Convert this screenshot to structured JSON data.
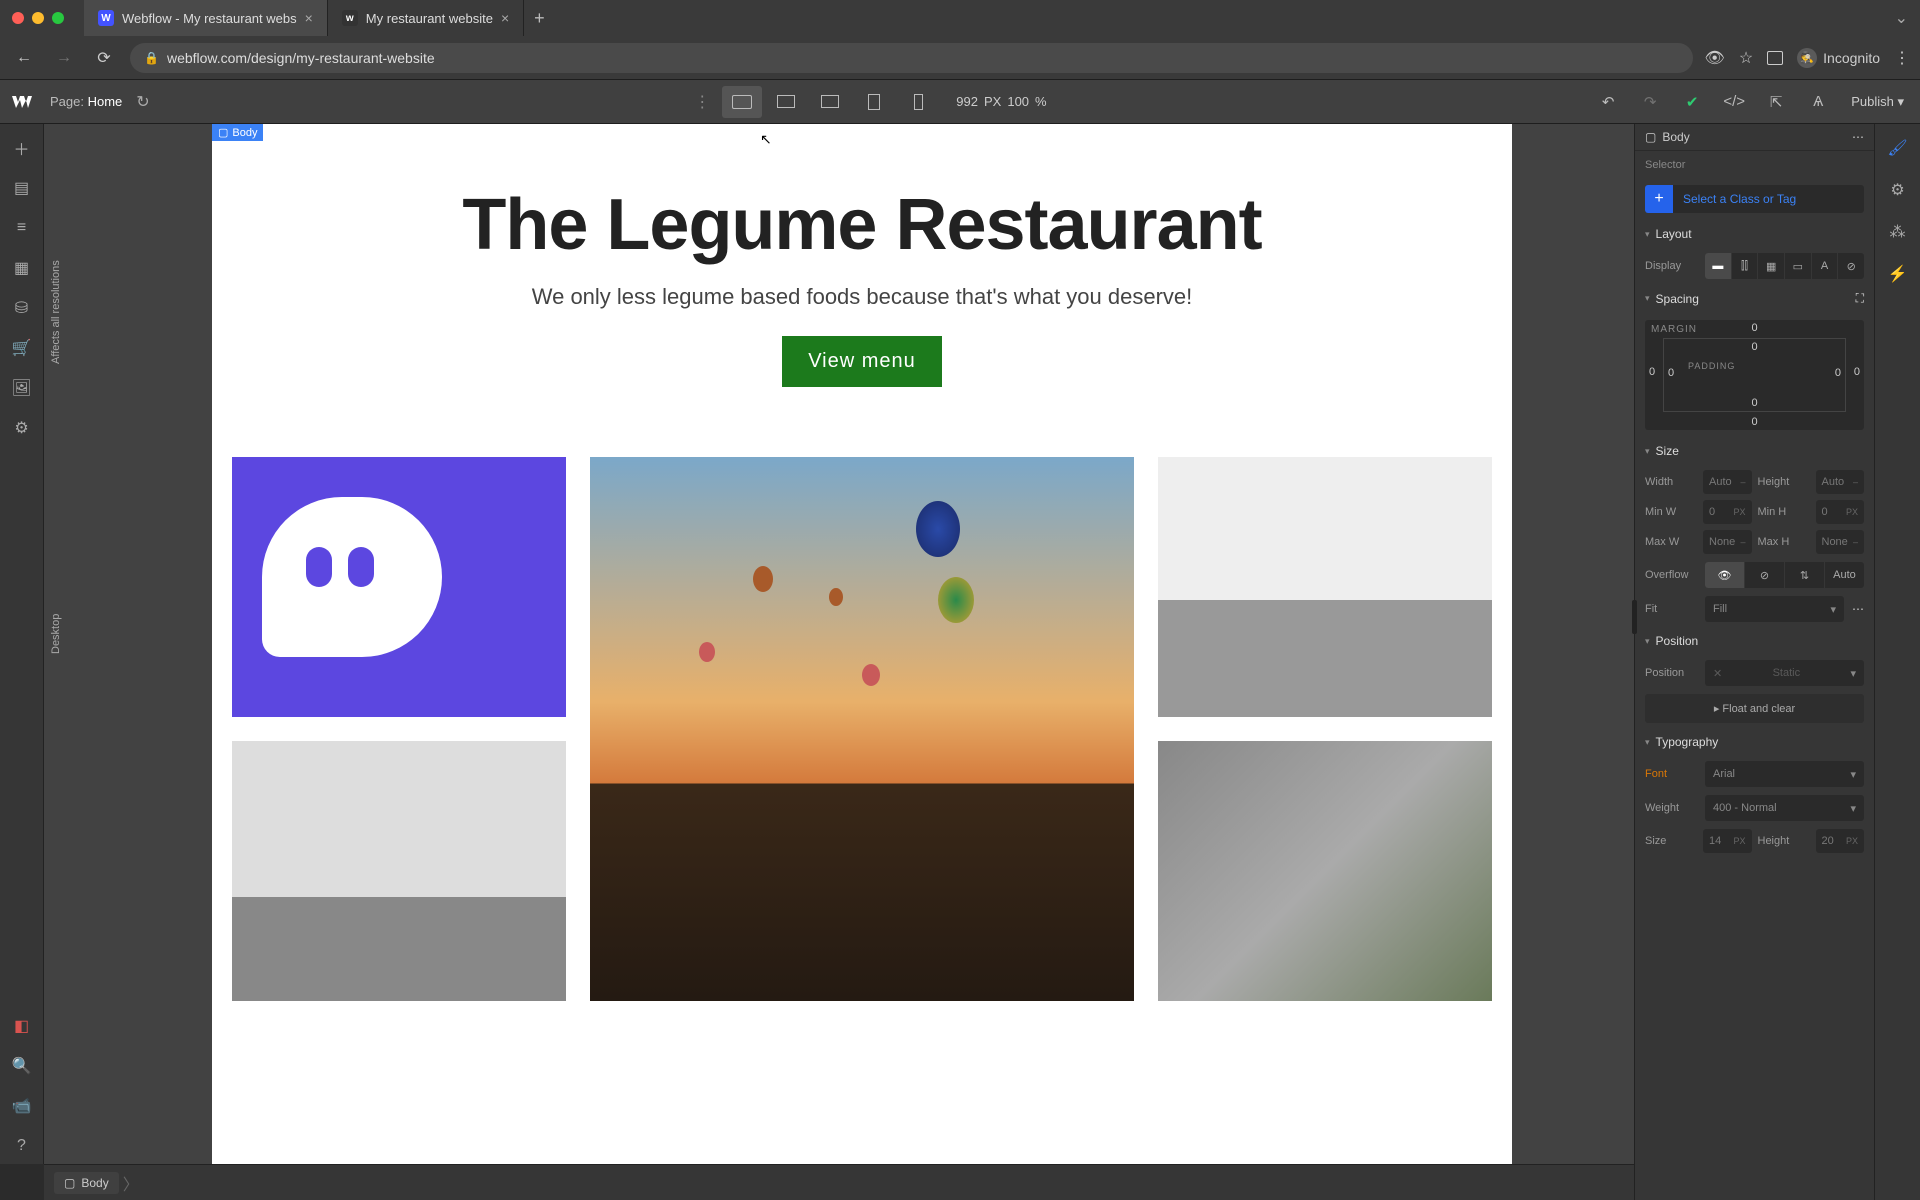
{
  "browser": {
    "tabs": [
      {
        "title": "Webflow - My restaurant webs",
        "active": true
      },
      {
        "title": "My restaurant website",
        "active": false
      }
    ],
    "url": "webflow.com/design/my-restaurant-website",
    "incognito_label": "Incognito"
  },
  "top": {
    "page_label": "Page:",
    "page_name": "Home",
    "viewport_px": "992",
    "viewport_unit": "PX",
    "zoom": "100",
    "zoom_unit": "%",
    "publish": "Publish"
  },
  "canvas": {
    "body_tag": "Body",
    "affects_label": "Affects all resolutions",
    "bp_label": "Desktop",
    "hero_title": "The Legume Restaurant",
    "hero_sub": "We only less legume based foods because that's what you deserve!",
    "cta": "View menu"
  },
  "breadcrumb": {
    "item": "Body"
  },
  "panel": {
    "element": "Body",
    "selector_head": "Selector",
    "selector_placeholder": "Select a Class or Tag",
    "layout": {
      "title": "Layout",
      "display_label": "Display"
    },
    "spacing": {
      "title": "Spacing",
      "margin_label": "MARGIN",
      "padding_label": "PADDING",
      "m_top": "0",
      "m_right": "0",
      "m_bottom": "0",
      "m_left": "0",
      "p_top": "0",
      "p_right": "0",
      "p_bottom": "0",
      "p_left": "0"
    },
    "size": {
      "title": "Size",
      "width_l": "Width",
      "width_v": "Auto",
      "height_l": "Height",
      "height_v": "Auto",
      "minw_l": "Min W",
      "minw_v": "0",
      "minw_u": "PX",
      "minh_l": "Min H",
      "minh_v": "0",
      "minh_u": "PX",
      "maxw_l": "Max W",
      "maxw_v": "None",
      "maxh_l": "Max H",
      "maxh_v": "None",
      "overflow_l": "Overflow",
      "overflow_auto": "Auto",
      "fit_l": "Fit",
      "fit_v": "Fill"
    },
    "position": {
      "title": "Position",
      "label": "Position",
      "value": "Static",
      "float": "Float and clear"
    },
    "typo": {
      "title": "Typography",
      "font_l": "Font",
      "font_v": "Arial",
      "weight_l": "Weight",
      "weight_v": "400 - Normal",
      "size_l": "Size",
      "size_v": "14",
      "size_u": "PX",
      "height_l": "Height",
      "height_v": "20",
      "height_u": "PX"
    }
  }
}
